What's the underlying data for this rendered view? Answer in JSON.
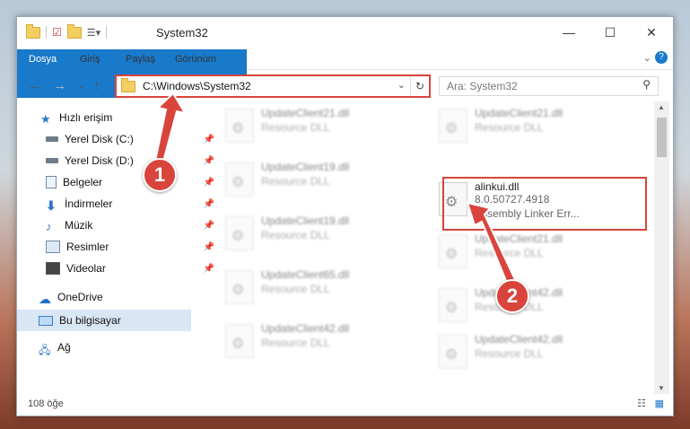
{
  "window": {
    "title": "System32",
    "min_icon": "minimize-icon",
    "max_icon": "maximize-icon",
    "close_icon": "close-icon"
  },
  "ribbon": {
    "tabs": [
      "Dosya",
      "Giriş",
      "Paylaş",
      "Görünüm"
    ]
  },
  "address": {
    "path": "C:\\Windows\\System32",
    "search_placeholder": "Ara: System32"
  },
  "sidebar": {
    "items": [
      {
        "label": "Hızlı erişim",
        "icon": "star-icon"
      },
      {
        "label": "Yerel Disk (C:)",
        "icon": "drive-icon"
      },
      {
        "label": "Yerel Disk (D:)",
        "icon": "drive-icon"
      },
      {
        "label": "Belgeler",
        "icon": "documents-icon"
      },
      {
        "label": "İndirmeler",
        "icon": "download-icon"
      },
      {
        "label": "Müzik",
        "icon": "music-icon"
      },
      {
        "label": "Resimler",
        "icon": "pictures-icon"
      },
      {
        "label": "Videolar",
        "icon": "videos-icon"
      },
      {
        "label": "OneDrive",
        "icon": "cloud-icon"
      },
      {
        "label": "Bu bilgisayar",
        "icon": "computer-icon"
      },
      {
        "label": "Ağ",
        "icon": "network-icon"
      }
    ]
  },
  "files": {
    "left": [
      {
        "name": "UpdateClient21.dll",
        "type": "Resource DLL"
      },
      {
        "name": "UpdateClient19.dll",
        "type": "Resource DLL"
      },
      {
        "name": "UpdateClient19.dll",
        "type": "Resource DLL"
      },
      {
        "name": "UpdateClient65.dll",
        "type": "Resource DLL"
      },
      {
        "name": "UpdateClient42.dll",
        "type": "Resource DLL"
      }
    ],
    "right": [
      {
        "name": "UpdateClient21.dll",
        "type": "Resource DLL"
      },
      {
        "name": "UpdateClient21.dll",
        "type": "Resource DLL"
      },
      {
        "name": "UpdateClient42.dll",
        "type": "Resource DLL"
      },
      {
        "name": "UpdateClient42.dll",
        "type": "Resource DLL"
      }
    ],
    "highlight": {
      "name": "alinkui.dll",
      "version": "8.0.50727.4918",
      "type": "Assembly Linker Err..."
    }
  },
  "status": {
    "count": "108 öğe"
  },
  "callouts": [
    "1",
    "2"
  ],
  "colors": {
    "accent": "#1979ca",
    "callout": "#d9443c"
  }
}
